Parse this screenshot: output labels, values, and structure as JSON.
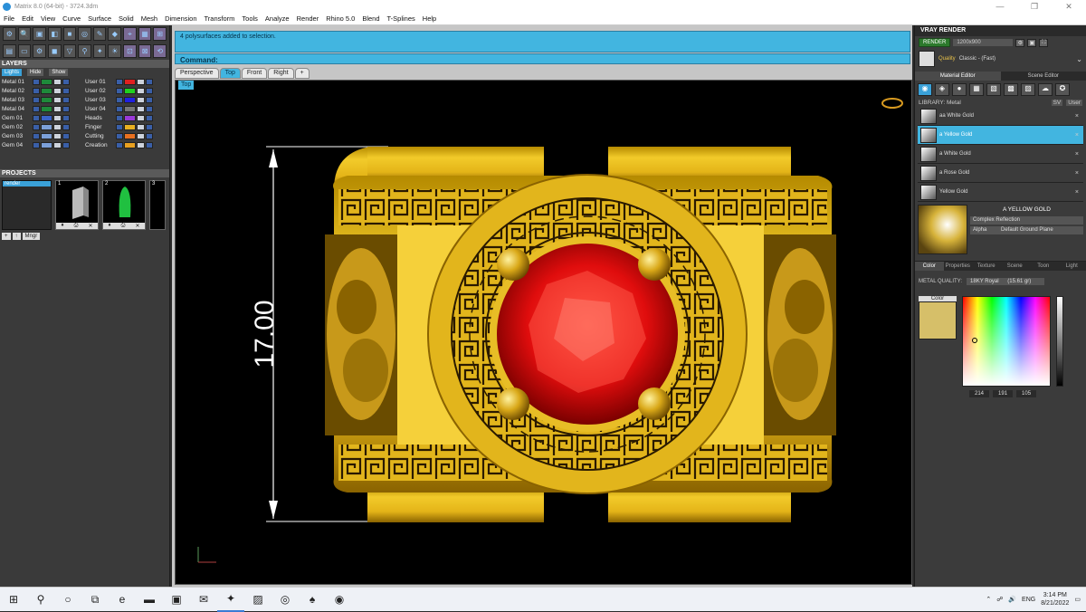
{
  "titlebar": {
    "title": "Matrix 8.0 (64-bit) - 3724.3dm",
    "min": "—",
    "max": "❐",
    "close": "✕"
  },
  "menu": [
    "File",
    "Edit",
    "View",
    "Curve",
    "Surface",
    "Solid",
    "Mesh",
    "Dimension",
    "Transform",
    "Tools",
    "Analyze",
    "Render",
    "Rhino 5.0",
    "Blend",
    "T-Splines",
    "Help"
  ],
  "layers": {
    "header": "LAYERS",
    "lights_label": "Lights",
    "hide_label": "Hide",
    "show_label": "Show",
    "left": [
      {
        "name": "Metal 01",
        "color": "#1e8a3a"
      },
      {
        "name": "Metal 02",
        "color": "#1e8a3a"
      },
      {
        "name": "Metal 03",
        "color": "#1e8a3a"
      },
      {
        "name": "Metal 04",
        "color": "#1e8a3a"
      },
      {
        "name": "Gem 01",
        "color": "#3a64c8"
      },
      {
        "name": "Gem 02",
        "color": "#7b9fd8"
      },
      {
        "name": "Gem 03",
        "color": "#7b9fd8"
      },
      {
        "name": "Gem 04",
        "color": "#7b9fd8"
      }
    ],
    "right": [
      {
        "name": "User 01",
        "color": "#e02020"
      },
      {
        "name": "User 02",
        "color": "#20d020"
      },
      {
        "name": "User 03",
        "color": "#2020e0"
      },
      {
        "name": "User 04",
        "color": "#777777"
      },
      {
        "name": "Heads",
        "color": "#9a3ad8"
      },
      {
        "name": "Finger",
        "color": "#e8b020"
      },
      {
        "name": "Cutting",
        "color": "#e87020"
      },
      {
        "name": "Creation",
        "color": "#e8a020"
      }
    ]
  },
  "projects": {
    "header": "PROJECTS",
    "items": [
      "render"
    ],
    "thumbs": [
      "1",
      "2",
      "3"
    ],
    "mngr": "Mngr"
  },
  "command": {
    "history": "4 polysurfaces added to selection.",
    "label": "Command:"
  },
  "viewport_tabs": [
    "Perspective",
    "Top",
    "Front",
    "Right",
    "+"
  ],
  "active_view": "Top",
  "dimension_text": "17.00",
  "vray": {
    "title": "VRAY RENDER",
    "render_btn": "RENDER",
    "resolution": "1200x900",
    "preset_label": "Quality",
    "preset_value": "Classic - (Fast)",
    "tabs": [
      "Material Editor",
      "Scene Editor"
    ],
    "library_label": "LIBRARY: Metal",
    "library_sv": "SV",
    "library_user": "User",
    "materials": [
      {
        "name": "aa White Gold"
      },
      {
        "name": "a Yellow Gold"
      },
      {
        "name": "a White Gold"
      },
      {
        "name": "a Rose Gold"
      },
      {
        "name": "Yellow Gold"
      }
    ],
    "preview_name": "A YELLOW GOLD",
    "reflection": "Complex Reflection",
    "alpha": "Alpha",
    "ground": "Default Ground Plane",
    "subtabs": [
      "Color",
      "Properties",
      "Texture",
      "Scene",
      "Toon",
      "Light"
    ],
    "metal_quality_label": "METAL QUALITY:",
    "metal_quality_value": "18KY Royal",
    "metal_quality_extra": "(15.61 gr)",
    "color_label": "Color",
    "swatch_color": "#d6bf69",
    "rgb": [
      "214",
      "191",
      "105"
    ]
  },
  "taskbar": {
    "lang": "ENG",
    "time": "3:14 PM",
    "date": "8/21/2022"
  }
}
